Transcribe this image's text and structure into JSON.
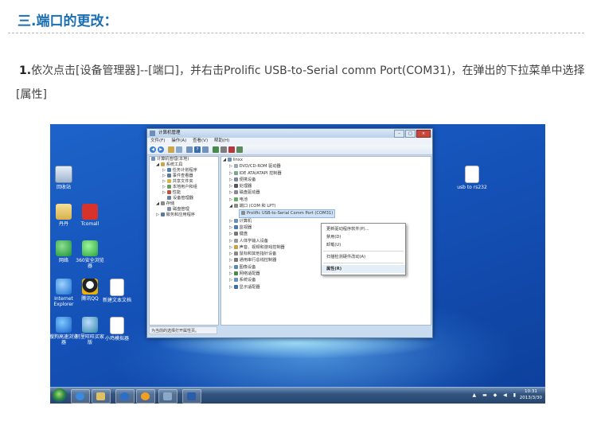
{
  "section": {
    "heading": "三.端口的更改：",
    "step_number": "1.",
    "step_text": "依次点击[设备管理器]--[端口]，并右击Prolific USB-to-Serial comm Port(COM31)，在弹出的下拉菜单中选择[属性]"
  },
  "screenshot": {
    "desktop_icons": [
      {
        "label": "回收站",
        "icon": "recycle-bin-icon"
      },
      {
        "label": "丹丹",
        "icon": "folder-icon"
      },
      {
        "label": "Tcomall",
        "icon": "app-icon"
      },
      {
        "label": "网络",
        "icon": "network-icon"
      },
      {
        "label": "360安全浏览器",
        "icon": "browser-icon"
      },
      {
        "label": "Internet Explorer",
        "icon": "ie-icon"
      },
      {
        "label": "腾讯QQ",
        "icon": "qq-icon"
      },
      {
        "label": "新建文本文档",
        "icon": "document-icon"
      },
      {
        "label": "搜狗高速浏览器",
        "icon": "sogou-icon"
      },
      {
        "label": "阿里旺旺买家版",
        "icon": "wangwang-icon"
      },
      {
        "label": "小鸡模拟器",
        "icon": "document-icon"
      },
      {
        "label": "usb to rs232",
        "icon": "folder-icon"
      }
    ],
    "window": {
      "title": "计算机管理",
      "menu": [
        "文件(F)",
        "操作(A)",
        "查看(V)",
        "帮助(H)"
      ],
      "left_tree": [
        {
          "label": "计算机管理(本地)",
          "level": 0
        },
        {
          "label": "系统工具",
          "level": 1
        },
        {
          "label": "任务计划程序",
          "level": 2
        },
        {
          "label": "事件查看器",
          "level": 2
        },
        {
          "label": "共享文件夹",
          "level": 2
        },
        {
          "label": "本地用户和组",
          "level": 2
        },
        {
          "label": "性能",
          "level": 2
        },
        {
          "label": "设备管理器",
          "level": 2
        },
        {
          "label": "存储",
          "level": 1
        },
        {
          "label": "磁盘管理",
          "level": 2
        },
        {
          "label": "服务和应用程序",
          "level": 1
        }
      ],
      "right_tree": [
        {
          "label": "linxx",
          "level": 0
        },
        {
          "label": "DVD/CD-ROM 驱动器",
          "level": 1
        },
        {
          "label": "IDE ATA/ATAPI 控制器",
          "level": 1
        },
        {
          "label": "便携设备",
          "level": 1
        },
        {
          "label": "处理器",
          "level": 1
        },
        {
          "label": "磁盘驱动器",
          "level": 1
        },
        {
          "label": "电池",
          "level": 1
        },
        {
          "label": "端口 (COM 和 LPT)",
          "level": 1
        },
        {
          "label": "Prolific USB-to-Serial Comm Port (COM31)",
          "level": 2
        },
        {
          "label": "计算机",
          "level": 1
        },
        {
          "label": "监视器",
          "level": 1
        },
        {
          "label": "键盘",
          "level": 1
        },
        {
          "label": "人体学输入设备",
          "level": 1
        },
        {
          "label": "声音、视频和游戏控制器",
          "level": 1
        },
        {
          "label": "鼠标和其他指针设备",
          "level": 1
        },
        {
          "label": "通用串行总线控制器",
          "level": 1
        },
        {
          "label": "图像设备",
          "level": 1
        },
        {
          "label": "网络适配器",
          "level": 1
        },
        {
          "label": "系统设备",
          "level": 1
        },
        {
          "label": "显示适配器",
          "level": 1
        }
      ],
      "status": "为当前的选择打开属性页。"
    },
    "context_menu": [
      "更新驱动程序软件(P)...",
      "禁用(D)",
      "卸载(U)",
      "扫描检测硬件改动(A)",
      "属性(R)"
    ],
    "clock": {
      "time": "10:31",
      "date": "2013/3/30"
    }
  }
}
